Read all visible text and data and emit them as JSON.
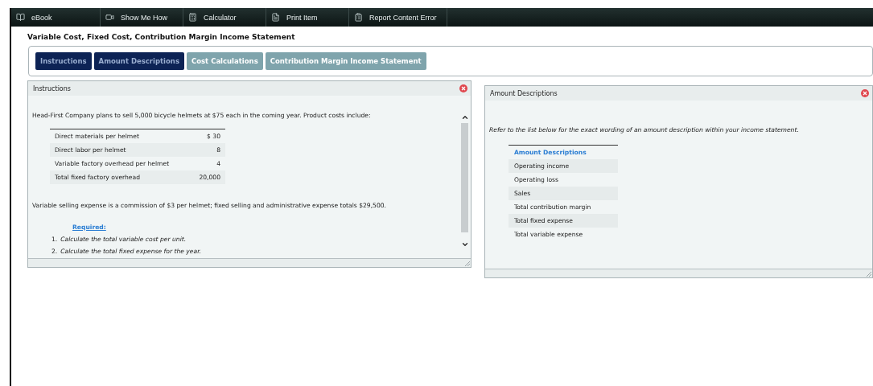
{
  "toolbar": [
    {
      "kind": "book",
      "label": "eBook"
    },
    {
      "kind": "video",
      "label": "Show Me How"
    },
    {
      "kind": "calculator",
      "label": "Calculator"
    },
    {
      "kind": "print",
      "label": "Print Item"
    },
    {
      "kind": "report",
      "label": "Report Content Error"
    }
  ],
  "title": "Variable Cost, Fixed Cost, Contribution Margin Income Statement",
  "tabs": [
    {
      "label": "Instructions",
      "selected": true
    },
    {
      "label": "Amount Descriptions",
      "selected": true
    },
    {
      "label": "Cost Calculations",
      "selected": false
    },
    {
      "label": "Contribution Margin Income Statement",
      "selected": false
    }
  ],
  "instructions": {
    "title": "Instructions",
    "intro": "Head-First Company plans to sell 5,000 bicycle helmets at $75 each in the coming year. Product costs include:",
    "costs": [
      {
        "label": "Direct materials per helmet",
        "value": "$ 30"
      },
      {
        "label": "Direct labor per helmet",
        "value": "8"
      },
      {
        "label": "Variable factory overhead per helmet",
        "value": "4"
      },
      {
        "label": "Total fixed factory overhead",
        "value": "20,000"
      }
    ],
    "note": "Variable selling expense is a commission of $3 per helmet; fixed selling and administrative expense totals $29,500.",
    "required_label": "Required:",
    "required": [
      {
        "number": "1.",
        "text": "Calculate the total variable cost per unit."
      },
      {
        "number": "2.",
        "text": "Calculate the total fixed expense for the year."
      }
    ]
  },
  "amount_descriptions": {
    "title": "Amount Descriptions",
    "intro": "Refer to the list below for the exact wording of an amount description within your income statement.",
    "heading": "Amount Descriptions",
    "items": [
      "Operating income",
      "Operating loss",
      "Sales",
      "Total contribution margin",
      "Total fixed expense",
      "Total variable expense"
    ]
  }
}
